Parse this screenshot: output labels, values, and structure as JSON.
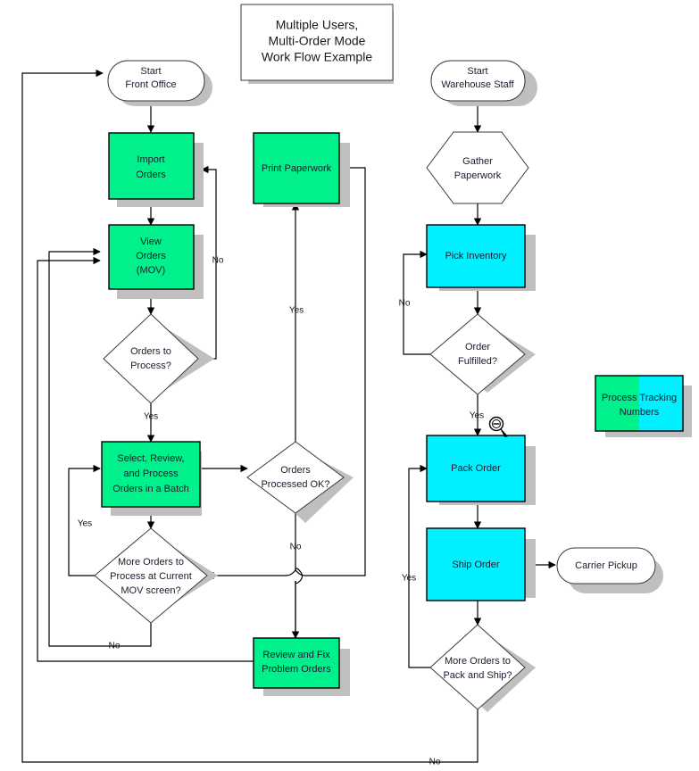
{
  "title": {
    "line1": "Multiple Users,",
    "line2": "Multi-Order Mode",
    "line3": "Work Flow Example"
  },
  "colors": {
    "process_green": "#00F08C",
    "process_cyan": "#00F0FF",
    "shadow": "#BFBFBF",
    "terminator_fill": "#FFFFFF",
    "decision_fill": "#FFFFFF",
    "line": "#000000",
    "text": "#1A1A2E"
  },
  "nodes": {
    "start_front_office": {
      "line1": "Start",
      "line2": "Front Office",
      "type": "terminator"
    },
    "import_orders": {
      "line1": "Import",
      "line2": "Orders",
      "type": "process-green"
    },
    "view_orders": {
      "line1": "View",
      "line2": "Orders",
      "line3": "(MOV)",
      "type": "process-green"
    },
    "orders_to_process": {
      "line1": "Orders to",
      "line2": "Process?",
      "type": "decision"
    },
    "select_review": {
      "line1": "Select, Review,",
      "line2": "and Process",
      "line3": "Orders in a Batch",
      "type": "process-green"
    },
    "more_orders_mov": {
      "line1": "More Orders to",
      "line2": "Process at Current",
      "line3": "MOV screen?",
      "type": "decision"
    },
    "print_paperwork": {
      "line1": "Print Paperwork",
      "type": "process-green"
    },
    "orders_processed_ok": {
      "line1": "Orders",
      "line2": "Processed OK?",
      "type": "decision"
    },
    "review_and_fix": {
      "line1": "Review and Fix",
      "line2": "Problem Orders",
      "type": "process-green"
    },
    "start_warehouse": {
      "line1": "Start",
      "line2": "Warehouse Staff",
      "type": "terminator"
    },
    "gather_paperwork": {
      "line1": "Gather",
      "line2": "Paperwork",
      "type": "hexagon"
    },
    "pick_inventory": {
      "line1": "Pick Inventory",
      "type": "process-cyan"
    },
    "order_fulfilled": {
      "line1": "Order",
      "line2": "Fulfilled?",
      "type": "decision"
    },
    "pack_order": {
      "line1": "Pack Order",
      "type": "process-cyan"
    },
    "ship_order": {
      "line1": "Ship Order",
      "type": "process-cyan"
    },
    "carrier_pickup": {
      "line1": "Carrier Pickup",
      "type": "terminator"
    },
    "more_orders_pack_ship": {
      "line1": "More Orders to",
      "line2": "Pack and Ship?",
      "type": "decision"
    }
  },
  "legend": {
    "line1": "Process Tracking",
    "line2": "Numbers",
    "left_color": "#00F08C",
    "right_color": "#00F0FF"
  },
  "edge_labels": {
    "orders_to_process_no": "No",
    "orders_to_process_yes": "Yes",
    "more_orders_mov_yes": "Yes",
    "more_orders_mov_no": "No",
    "orders_processed_ok_yes": "Yes",
    "orders_processed_ok_no": "No",
    "order_fulfilled_no": "No",
    "order_fulfilled_yes": "Yes",
    "more_orders_pack_ship_yes": "Yes",
    "more_orders_pack_ship_no": "No"
  },
  "cursor": {
    "icon": "zoom-out-magnifier-cursor"
  }
}
